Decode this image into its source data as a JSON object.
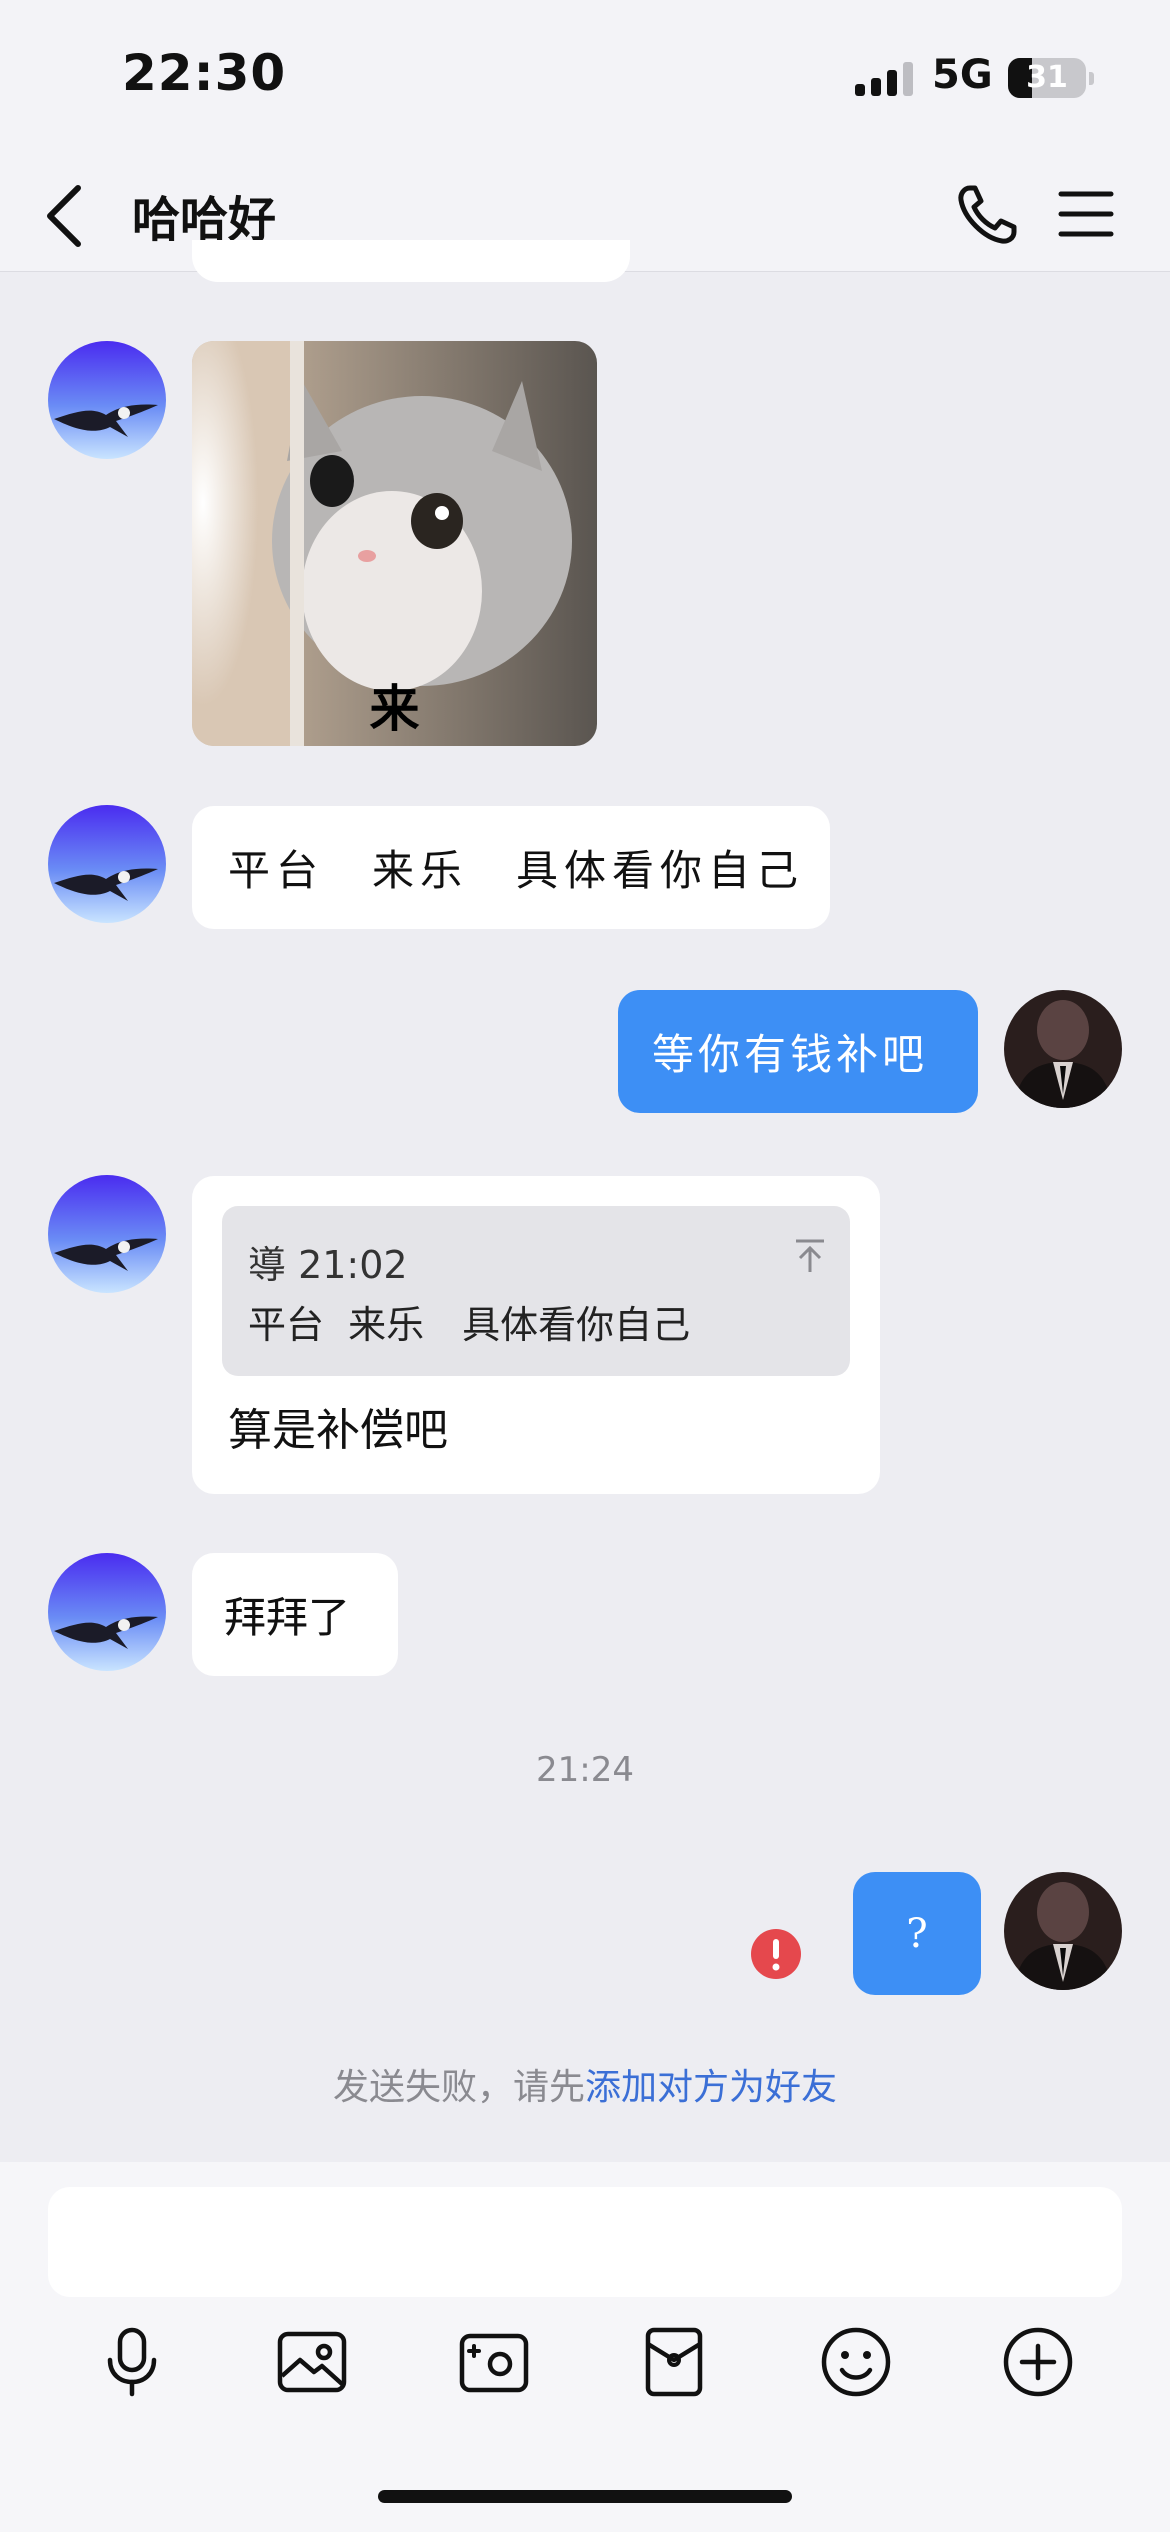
{
  "status_bar": {
    "time": "22:30",
    "network": "5G",
    "battery": "31",
    "battery_level": 0.31
  },
  "header": {
    "title": "哈哈好",
    "icons": [
      "back-icon",
      "phone-icon",
      "menu-icon"
    ]
  },
  "messages": {
    "sticker_caption": "来",
    "m1_text": "平台　来乐　具体看你自己",
    "m2_text": "等你有钱补吧",
    "m3_quote_meta": "導 21:02",
    "m3_quote_text": "平台  来乐　具体看你自己",
    "m3_text": "算是补偿吧",
    "m4_text": "拜拜了",
    "timestamp": "21:24",
    "m5_text": "?"
  },
  "system": {
    "fail_prefix": "发送失败，请先",
    "fail_link": "添加对方为好友"
  },
  "input": {
    "placeholder": ""
  },
  "toolbar": {
    "icons": [
      "microphone-icon",
      "photo-icon",
      "camera-icon",
      "red-packet-icon",
      "emoji-icon",
      "plus-icon"
    ]
  },
  "colors": {
    "background": "#ededf2",
    "outgoing_bubble": "#3d8ff5",
    "incoming_bubble": "#ffffff",
    "link": "#3b6fd6",
    "error": "#e5484d"
  }
}
